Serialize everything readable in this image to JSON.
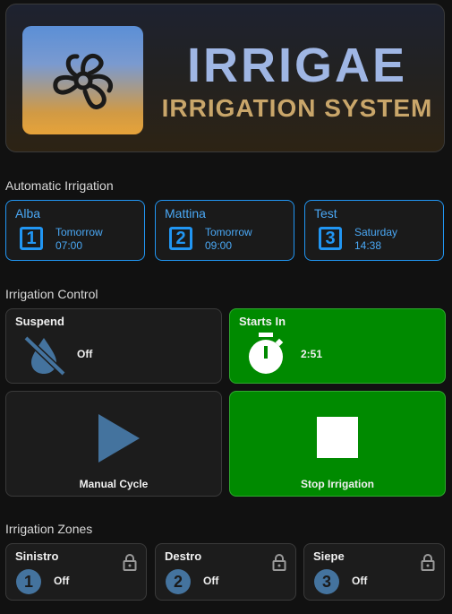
{
  "banner": {
    "title": "IRRIGAE",
    "subtitle": "IRRIGATION SYSTEM"
  },
  "sections": {
    "automatic": "Automatic Irrigation",
    "control": "Irrigation Control",
    "zones": "Irrigation Zones"
  },
  "automatic": [
    {
      "name": "Alba",
      "number": "1",
      "day": "Tomorrow",
      "time": "07:00"
    },
    {
      "name": "Mattina",
      "number": "2",
      "day": "Tomorrow",
      "time": "09:00"
    },
    {
      "name": "Test",
      "number": "3",
      "day": "Saturday",
      "time": "14:38"
    }
  ],
  "control": {
    "suspend": {
      "title": "Suspend",
      "state": "Off",
      "icon": "water-off-icon"
    },
    "starts_in": {
      "title": "Starts In",
      "state": "2:51",
      "icon": "timer-icon"
    },
    "manual": {
      "label": "Manual Cycle",
      "icon": "play-icon"
    },
    "stop": {
      "label": "Stop Irrigation",
      "icon": "stop-icon"
    }
  },
  "zones": [
    {
      "name": "Sinistro",
      "number": "1",
      "state": "Off"
    },
    {
      "name": "Destro",
      "number": "2",
      "state": "Off"
    },
    {
      "name": "Siepe",
      "number": "3",
      "state": "Off"
    }
  ],
  "colors": {
    "accent_blue": "#2196f3",
    "active_green": "#008a00",
    "zone_badge": "#44739e",
    "icon_blue": "#44739e"
  }
}
